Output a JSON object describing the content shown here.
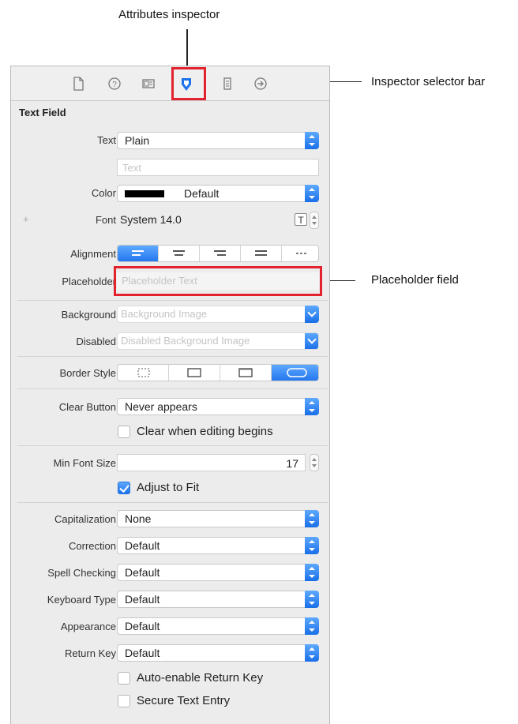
{
  "callouts": {
    "attributes_inspector": "Attributes inspector",
    "inspector_selector_bar": "Inspector selector bar",
    "placeholder_field": "Placeholder field"
  },
  "selector_bar": {
    "icons": [
      "file-icon",
      "help-icon",
      "identity-icon",
      "attributes-icon",
      "size-icon",
      "connections-icon"
    ],
    "selected": "attributes-icon"
  },
  "section": {
    "title": "Text Field"
  },
  "rows": {
    "text": {
      "label": "Text",
      "value": "Plain"
    },
    "text_input": {
      "placeholder": "Text"
    },
    "color": {
      "label": "Color",
      "value": "Default",
      "swatch": "#000000"
    },
    "font": {
      "plus": "+",
      "label": "Font",
      "value": "System 14.0",
      "button_glyph": "T"
    },
    "alignment": {
      "label": "Alignment",
      "selected_index": 0
    },
    "placeholder": {
      "label": "Placeholder",
      "placeholder": "Placeholder Text"
    },
    "background": {
      "label": "Background",
      "placeholder": "Background Image"
    },
    "disabled": {
      "label": "Disabled",
      "placeholder": "Disabled Background Image"
    },
    "border_style": {
      "label": "Border Style",
      "selected_index": 3
    },
    "clear_button": {
      "label": "Clear Button",
      "value": "Never appears"
    },
    "clear_when_editing": {
      "label": "Clear when editing begins",
      "checked": false
    },
    "min_font_size": {
      "label": "Min Font Size",
      "value": "17"
    },
    "adjust_to_fit": {
      "label": "Adjust to Fit",
      "checked": true
    },
    "capitalization": {
      "label": "Capitalization",
      "value": "None"
    },
    "correction": {
      "label": "Correction",
      "value": "Default"
    },
    "spell_checking": {
      "label": "Spell Checking",
      "value": "Default"
    },
    "keyboard_type": {
      "label": "Keyboard Type",
      "value": "Default"
    },
    "appearance": {
      "label": "Appearance",
      "value": "Default"
    },
    "return_key": {
      "label": "Return Key",
      "value": "Default"
    },
    "auto_enable_return_key": {
      "label": "Auto-enable Return Key",
      "checked": false
    },
    "secure_text_entry": {
      "label": "Secure Text Entry",
      "checked": false
    }
  },
  "colors": {
    "accent": "#1f73ea",
    "highlight": "#e2232e",
    "panel_bg": "#ececec"
  }
}
